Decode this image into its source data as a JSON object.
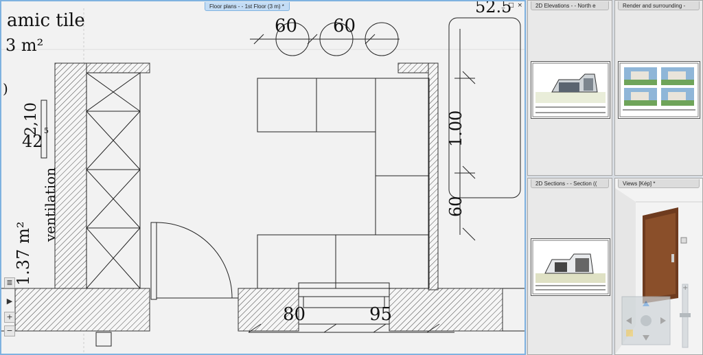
{
  "main_view": {
    "tab_title": "Floor plans -  - 1st Floor (3 m) *",
    "window_controls": "_ □ ×",
    "labels": {
      "ceramic": "amic tile",
      "area_top": "3 m²",
      "area_left": "1.37 m²",
      "ventilation": "ventilation",
      "paren": ")",
      "dim_210": "2,10",
      "dim_42": "42",
      "dim_sup5": "5",
      "dim_60a": "60",
      "dim_60b": "60",
      "dim_100": "1.00",
      "dim_60c": "60",
      "dim_80": "80",
      "dim_95": "95",
      "dim_top_right": "52.5"
    }
  },
  "nav_controls": {
    "layers": "≣",
    "play": "▶",
    "zoom_in": "+",
    "zoom_out": "−"
  },
  "side_panels": [
    {
      "title": "2D Elevations -  - North e"
    },
    {
      "title": "Render and surrounding -"
    },
    {
      "title": "2D Sections -  - Section (("
    },
    {
      "title": "Views [Kép] *"
    }
  ]
}
